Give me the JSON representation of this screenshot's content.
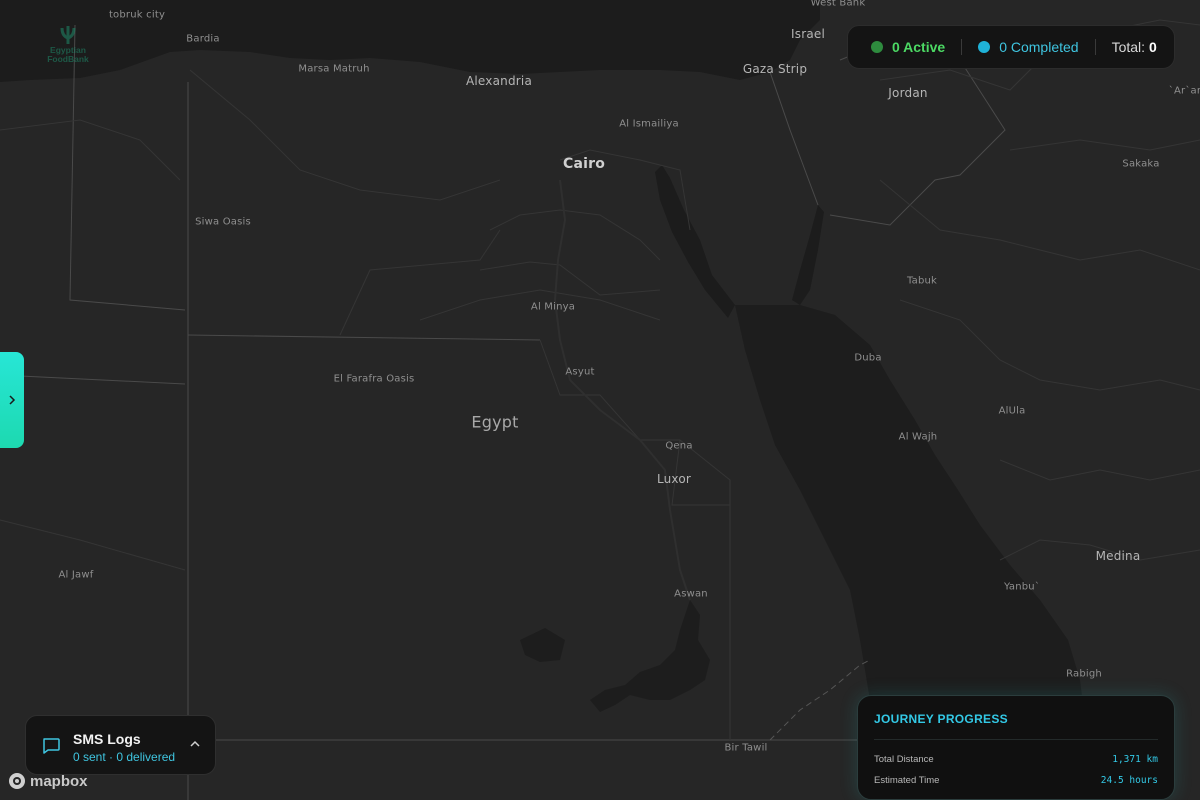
{
  "map": {
    "places": [
      {
        "name": "tobruk city",
        "kind": "town"
      },
      {
        "name": "Bardia",
        "kind": "town"
      },
      {
        "name": "Marsa Matruh",
        "kind": "town"
      },
      {
        "name": "Alexandria",
        "kind": "city"
      },
      {
        "name": "West Bank",
        "kind": "town"
      },
      {
        "name": "Israel",
        "kind": "city"
      },
      {
        "name": "Gaza Strip",
        "kind": "city"
      },
      {
        "name": "Jordan",
        "kind": "city"
      },
      {
        "name": "`Ar`ar",
        "kind": "town"
      },
      {
        "name": "Al Ismailiya",
        "kind": "town"
      },
      {
        "name": "Cairo",
        "kind": "city-big"
      },
      {
        "name": "Sakaka",
        "kind": "town"
      },
      {
        "name": "Siwa Oasis",
        "kind": "town"
      },
      {
        "name": "Tabuk",
        "kind": "town"
      },
      {
        "name": "Al Minya",
        "kind": "town"
      },
      {
        "name": "Duba",
        "kind": "town"
      },
      {
        "name": "Asyut",
        "kind": "town"
      },
      {
        "name": "El Farafra Oasis",
        "kind": "town"
      },
      {
        "name": "AlUla",
        "kind": "town"
      },
      {
        "name": "Egypt",
        "kind": "country"
      },
      {
        "name": "Al Wajh",
        "kind": "town"
      },
      {
        "name": "Qena",
        "kind": "town"
      },
      {
        "name": "Luxor",
        "kind": "city"
      },
      {
        "name": "Medina",
        "kind": "city"
      },
      {
        "name": "Al Jawf",
        "kind": "town"
      },
      {
        "name": "Yanbu`",
        "kind": "town"
      },
      {
        "name": "Aswan",
        "kind": "town"
      },
      {
        "name": "Rabigh",
        "kind": "town"
      },
      {
        "name": "Bir Tawil",
        "kind": "town"
      }
    ]
  },
  "logo": {
    "line1": "Egyptian",
    "line2": "FoodBank"
  },
  "status": {
    "active_label": "0 Active",
    "completed_label": "0 Completed",
    "total_label": "Total:",
    "total_value": "0",
    "active_color": "#2e8b3e",
    "completed_color": "#1fb2d8"
  },
  "sms": {
    "title": "SMS Logs",
    "subtitle": "0 sent · 0 delivered"
  },
  "attribution": "mapbox",
  "journey": {
    "title": "JOURNEY PROGRESS",
    "rows": [
      {
        "label": "Total Distance",
        "value": "1,371 km"
      },
      {
        "label": "Estimated Time",
        "value": "24.5 hours"
      }
    ]
  },
  "colors": {
    "accent": "#33c9e6",
    "toggle": "#1dd9b0",
    "land": "#262626",
    "sea": "#1b1b1b"
  }
}
